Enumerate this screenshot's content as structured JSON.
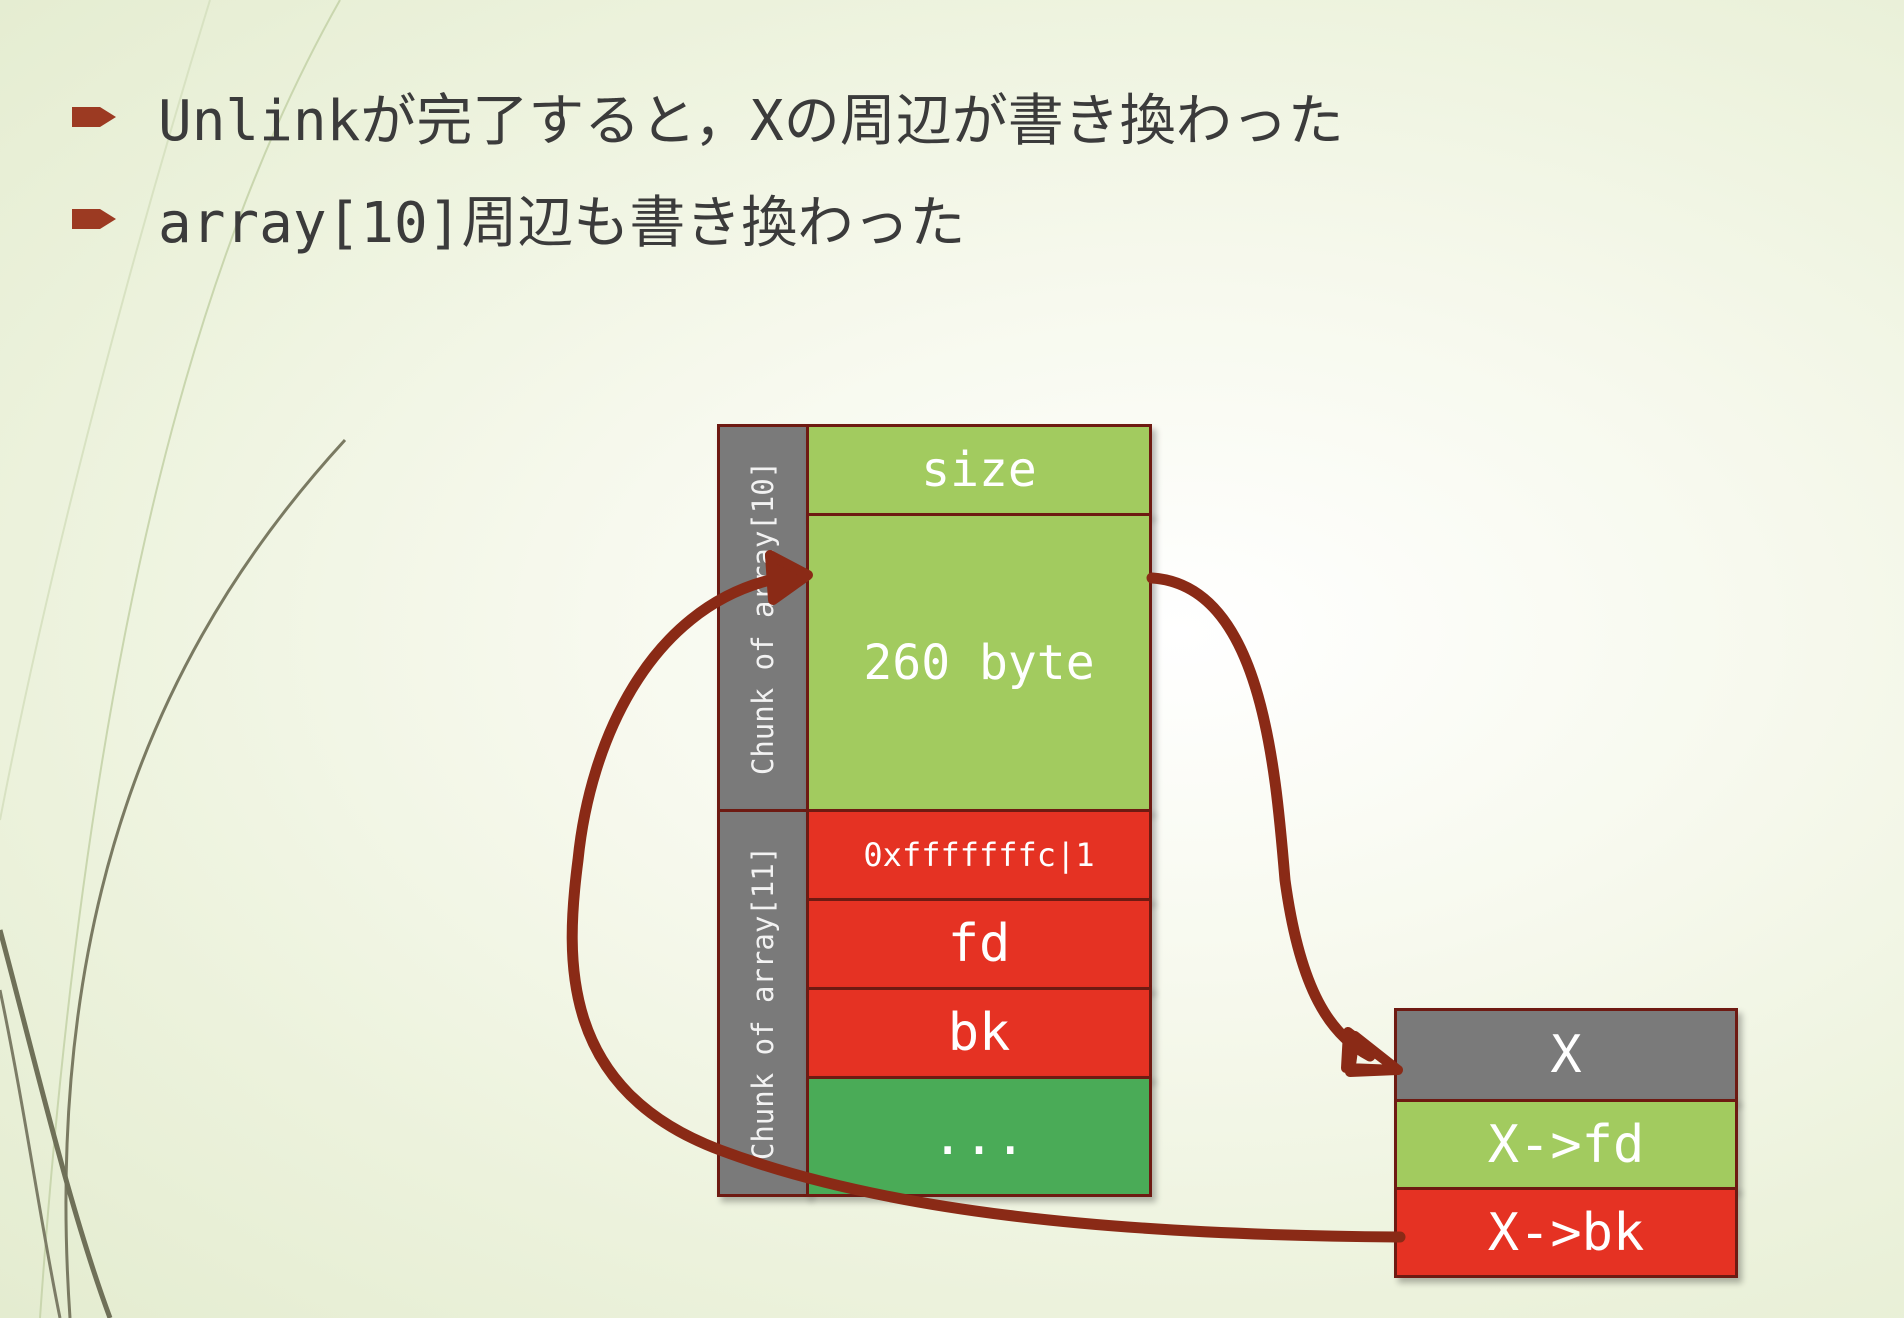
{
  "bullets": [
    "Unlinkが完了すると，Xの周辺が書き換わった",
    "array[10]周辺も書き換わった"
  ],
  "chunks": {
    "array10_label": "Chunk of array[10]",
    "array11_label": "Chunk of array[11]",
    "size": "size",
    "data260": "260 byte",
    "prev_size": "0xfffffffc|1",
    "fd": "fd",
    "bk": "bk",
    "rest": "..."
  },
  "x_struct": {
    "x": "X",
    "x_fd": "X->fd",
    "x_bk": "X->bk"
  },
  "colors": {
    "light_green": "#a2cb5f",
    "red": "#e53223",
    "dark_green": "#4aab57",
    "gray": "#7a7a7a",
    "arrow": "#8a2a16",
    "bullet": "#9c3a22"
  }
}
